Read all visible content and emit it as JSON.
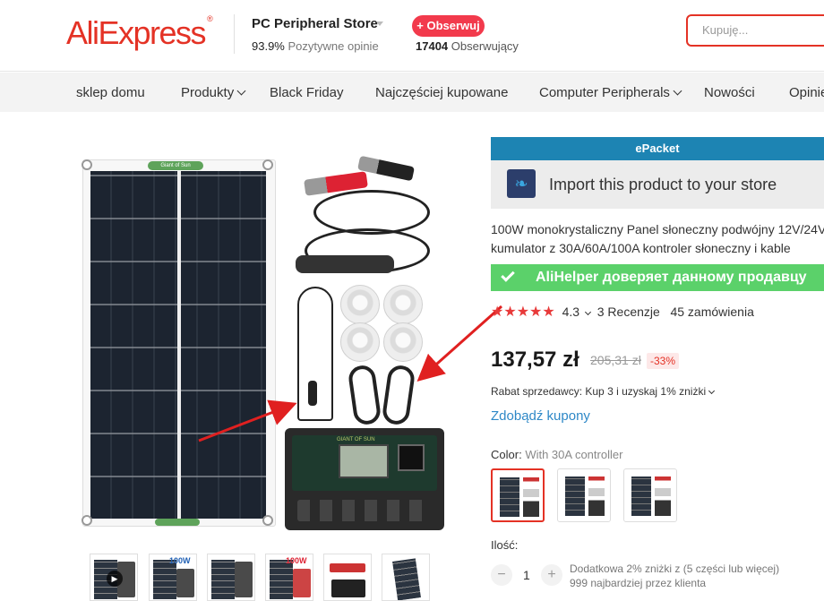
{
  "header": {
    "logo": "AliExpress",
    "store_name": "PC Peripheral Store",
    "positive_pct": "93.9%",
    "positive_label": "Pozytywne opinie",
    "follow_label": "+ Obserwuj",
    "followers_count": "17404",
    "followers_label": "Obserwujący",
    "search_placeholder": "Kupuję..."
  },
  "nav": {
    "items": [
      {
        "label": "sklep domu"
      },
      {
        "label": "Produkty"
      },
      {
        "label": "Black Friday"
      },
      {
        "label": "Najczęściej kupowane"
      },
      {
        "label": "Computer Peripherals"
      },
      {
        "label": "Nowości"
      },
      {
        "label": "Opinie"
      }
    ]
  },
  "gallery": {
    "panel_label": "Giant of Sun",
    "controller_label": "GIANT OF SUN",
    "thumb_badge": "100W",
    "play_icon": "▶"
  },
  "product": {
    "shipping_badge": "ePacket",
    "import_text": "Import this product to your store",
    "title_line1": "100W monokrystaliczny Panel słoneczny podwójny 12V/24V",
    "title_line2": "kumulator z 30A/60A/100A kontroler słoneczny i kable",
    "alihelper_text": "AliHelper доверяет данному продавцу",
    "stars": "★★★★★",
    "rating": "4.3",
    "reviews": "3 Recenzje",
    "orders": "45 zamówienia",
    "price": "137,57 zł",
    "old_price": "205,31 zł",
    "discount": "-33%",
    "seller_discount": "Rabat sprzedawcy: Kup 3 i uzyskaj 1% zniżki",
    "coupons_link": "Zdobądź kupony",
    "color_label": "Color:",
    "color_value": "With 30A controller",
    "qty_label": "Ilość:",
    "qty_minus": "−",
    "qty_value": "1",
    "qty_plus": "+",
    "qty_note_line1": "Dodatkowa 2% zniżki z (5 części lub więcej)",
    "qty_note_line2": "999 najbardziej przez klienta"
  },
  "colors": {
    "brand_red": "#e43225",
    "epacket_blue": "#1d84b3",
    "alihelper_green": "#5bd16a",
    "link_blue": "#2e88c7"
  }
}
